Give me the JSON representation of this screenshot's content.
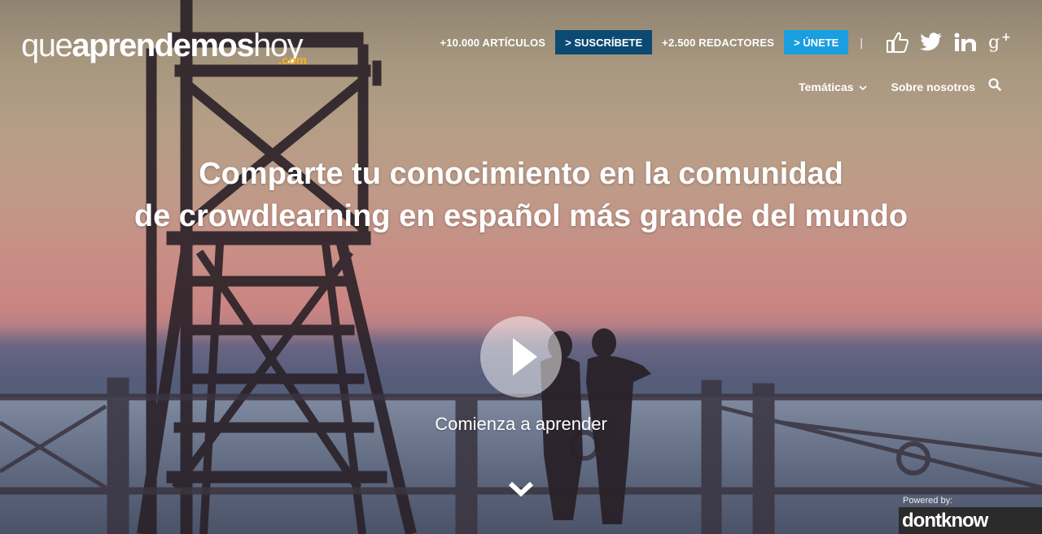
{
  "header": {
    "logo_thin": "que",
    "logo_bold": "aprendemos",
    "logo_thin2": "hoy",
    "logo_suffix": ".com",
    "articles_stat": "+10.000 ARTÍCULOS",
    "subscribe_label": "> SUSCRÍBETE",
    "writers_stat": "+2.500 REDACTORES",
    "join_label": "> ÚNETE",
    "separator": "|",
    "social": [
      "like-icon",
      "twitter-icon",
      "linkedin-icon",
      "google-plus-icon"
    ]
  },
  "nav": {
    "items": [
      {
        "label": "Temáticas",
        "has_dropdown": true
      },
      {
        "label": "Sobre nosotros",
        "has_dropdown": false
      }
    ],
    "search_icon": "search-icon"
  },
  "hero": {
    "headline_line1": "Comparte tu conocimiento en la comunidad",
    "headline_line2": "de crowdlearning en español más grande del mundo",
    "play_icon": "play-icon",
    "cta_label": "Comienza a aprender",
    "scroll_icon": "chevron-down-icon"
  },
  "powered": {
    "label": "Powered by:",
    "brand": "dontknow"
  },
  "colors": {
    "subscribe_bg": "#0b4a73",
    "join_bg": "#1a9ee0",
    "logo_suffix": "#f5b21a"
  }
}
